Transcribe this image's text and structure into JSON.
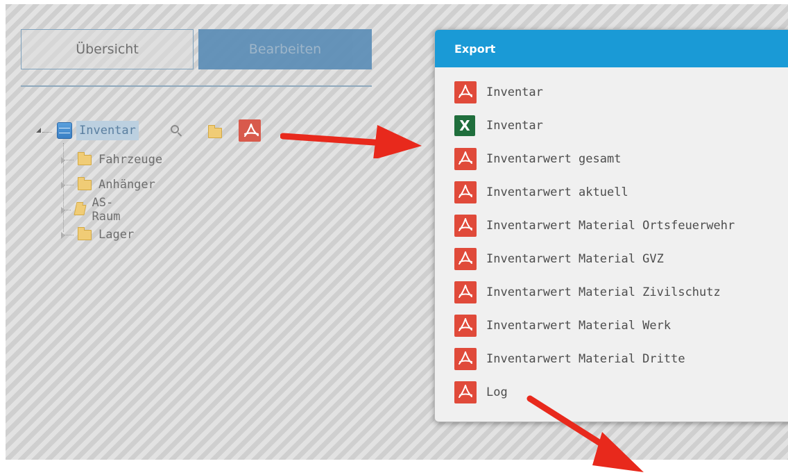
{
  "tabs": {
    "uebersicht": "Übersicht",
    "bearbeiten": "Bearbeiten"
  },
  "tree": {
    "root": {
      "label": "Inventar",
      "icon": "database-icon"
    },
    "children": [
      {
        "label": "Fahrzeuge",
        "icon": "folder-icon"
      },
      {
        "label": "Anhänger",
        "icon": "folder-icon"
      },
      {
        "label": "AS-Raum",
        "icon": "folder-open-icon"
      },
      {
        "label": "Lager",
        "icon": "folder-icon"
      }
    ],
    "toolbar_icons": [
      "search-icon",
      "folder-icon",
      "pdf-icon"
    ]
  },
  "export": {
    "title": "Export",
    "items": [
      {
        "label": "Inventar",
        "icon": "pdf-icon"
      },
      {
        "label": "Inventar",
        "icon": "excel-icon"
      },
      {
        "label": "Inventarwert gesamt",
        "icon": "pdf-icon"
      },
      {
        "label": "Inventarwert aktuell",
        "icon": "pdf-icon"
      },
      {
        "label": "Inventarwert Material Ortsfeuerwehr",
        "icon": "pdf-icon"
      },
      {
        "label": "Inventarwert Material GVZ",
        "icon": "pdf-icon"
      },
      {
        "label": "Inventarwert Material Zivilschutz",
        "icon": "pdf-icon"
      },
      {
        "label": "Inventarwert Material Werk",
        "icon": "pdf-icon"
      },
      {
        "label": "Inventarwert Material Dritte",
        "icon": "pdf-icon"
      },
      {
        "label": "Log",
        "icon": "pdf-icon"
      }
    ],
    "excel_glyph": "X"
  },
  "colors": {
    "header": "#1a9ad6",
    "pdf": "#e04a3a",
    "excel": "#1f6e3c",
    "arrow": "#e8291c"
  }
}
